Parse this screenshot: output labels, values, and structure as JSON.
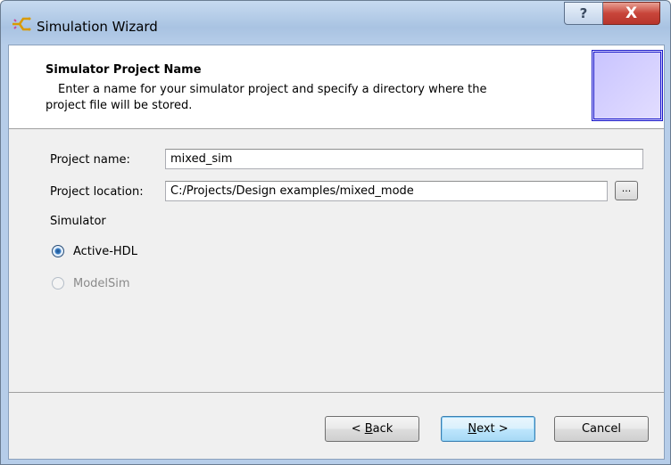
{
  "window": {
    "title": "Simulation Wizard",
    "help_label": "?",
    "close_label": "X",
    "icon": "fork-app-icon"
  },
  "header": {
    "title": "Simulator Project Name",
    "desc_line1": "Enter a name for your simulator project and specify a directory where the",
    "desc_line2": "project file will be stored."
  },
  "form": {
    "project_name_label": "Project name:",
    "project_name_value": "mixed_sim",
    "project_location_label": "Project location:",
    "project_location_value": "C:/Projects/Design examples/mixed_mode",
    "browse_label": "...",
    "simulator_label": "Simulator",
    "simulators": [
      {
        "label": "Active-HDL",
        "selected": true,
        "enabled": true
      },
      {
        "label": "ModelSim",
        "selected": false,
        "enabled": false
      }
    ]
  },
  "buttons": {
    "back": {
      "pre": "< ",
      "mnemonic": "B",
      "post": "ack"
    },
    "next": {
      "pre": "",
      "mnemonic": "N",
      "post": "ext >"
    },
    "cancel": "Cancel"
  },
  "colors": {
    "disabled_text": "#8a8a8a",
    "accent": "#3c7fb1"
  }
}
